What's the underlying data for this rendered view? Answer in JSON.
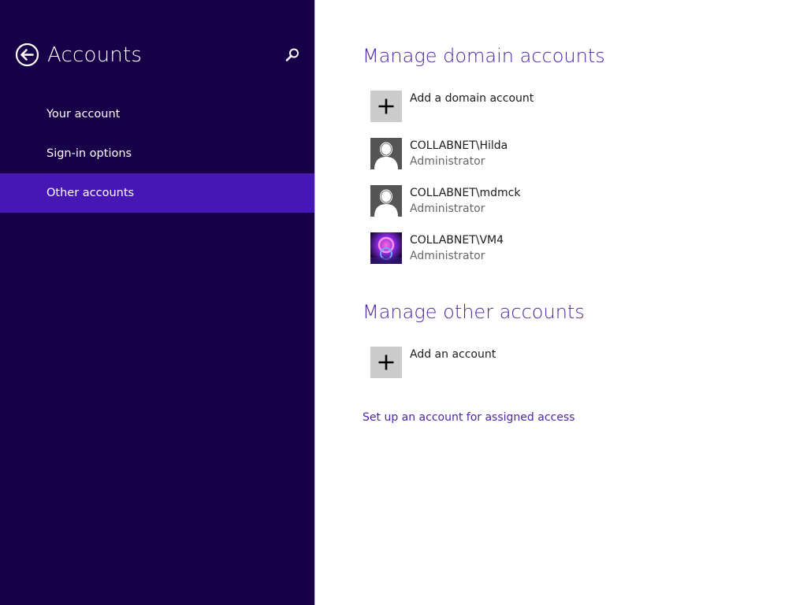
{
  "nav": {
    "title": "Accounts",
    "items": [
      {
        "label": "Your account",
        "selected": false
      },
      {
        "label": "Sign-in options",
        "selected": false
      },
      {
        "label": "Other accounts",
        "selected": true
      }
    ],
    "back_icon": "back-arrow-icon",
    "search_icon": "search-icon"
  },
  "domain_section": {
    "title": "Manage domain accounts",
    "add_label": "Add a domain account",
    "accounts": [
      {
        "name": "COLLABNET\\Hilda",
        "role": "Administrator",
        "avatar": "user-silhouette-icon"
      },
      {
        "name": "COLLABNET\\mdmck",
        "role": "Administrator",
        "avatar": "user-silhouette-icon"
      },
      {
        "name": "COLLABNET\\VM4",
        "role": "Administrator",
        "avatar": "user-picture"
      }
    ]
  },
  "other_section": {
    "title": "Manage other accounts",
    "add_label": "Add an account"
  },
  "assigned_access_link": "Set up an account for assigned access",
  "colors": {
    "nav_background": "#180048",
    "nav_selected": "#4617b4",
    "accent_text": "#4c23a8",
    "add_tile": "#cccccc",
    "avatar_tile": "#555555"
  }
}
